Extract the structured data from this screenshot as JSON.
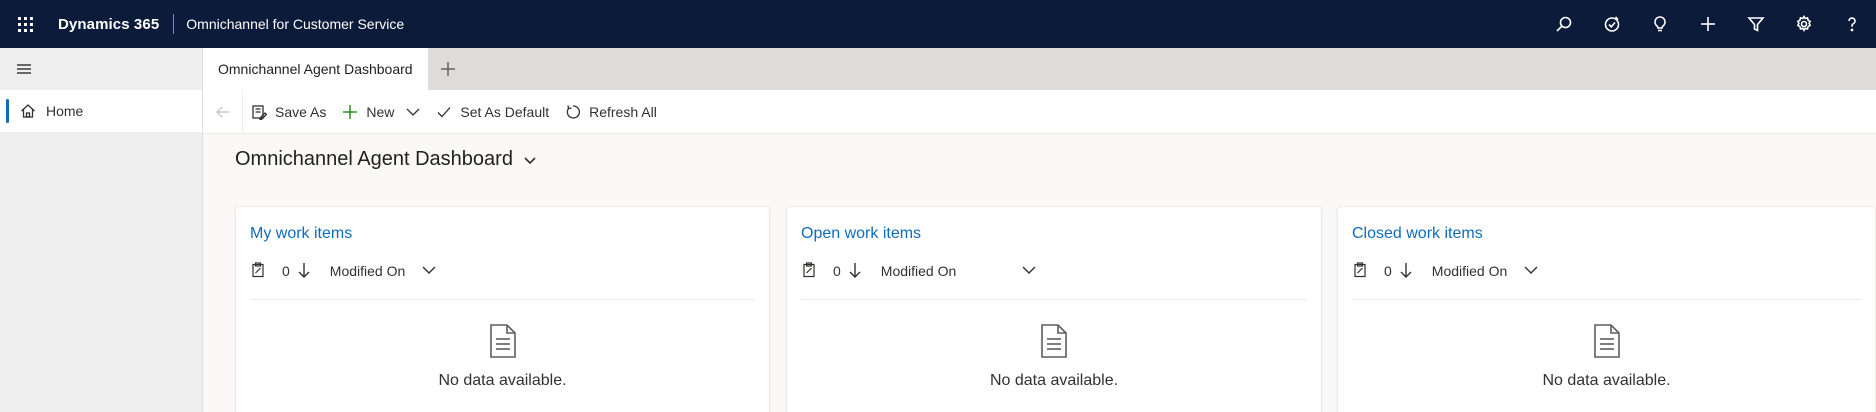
{
  "topbar": {
    "brand": "Dynamics 365",
    "app_name": "Omnichannel for Customer Service",
    "icons": [
      "search-icon",
      "task-check-icon",
      "lightbulb-icon",
      "plus-icon",
      "filter-icon",
      "gear-icon",
      "help-icon"
    ]
  },
  "leftnav": {
    "items": [
      {
        "label": "Home",
        "icon": "home-icon",
        "selected": true
      }
    ]
  },
  "tabs": {
    "active_label": "Omnichannel Agent Dashboard"
  },
  "commandbar": {
    "save_as": "Save As",
    "new": "New",
    "set_as_default": "Set As Default",
    "refresh_all": "Refresh All"
  },
  "dashboard": {
    "title": "Omnichannel Agent Dashboard",
    "cards": [
      {
        "title": "My work items",
        "count": "0",
        "sort_by": "Modified On",
        "empty_text": "No data available."
      },
      {
        "title": "Open work items",
        "count": "0",
        "sort_by": "Modified On",
        "empty_text": "No data available."
      },
      {
        "title": "Closed work items",
        "count": "0",
        "sort_by": "Modified On",
        "empty_text": "No data available."
      }
    ]
  },
  "colors": {
    "topbar_bg": "#0c1b3a",
    "accent": "#0f6cbd",
    "new_plus": "#107c10"
  }
}
